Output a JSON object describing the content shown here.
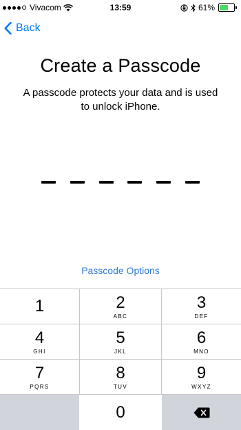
{
  "status_bar": {
    "carrier": "Vivacom",
    "time": "13:59",
    "battery_percent": "61%",
    "battery_level": 0.61,
    "battery_color": "#4cd964"
  },
  "nav": {
    "back_label": "Back",
    "accent_color": "#007aff"
  },
  "main": {
    "title": "Create a Passcode",
    "description": "A passcode protects your data and is used to unlock iPhone.",
    "options_label": "Passcode Options",
    "dash_count": 6
  },
  "keypad": {
    "keys": [
      {
        "digit": "1",
        "letters": ""
      },
      {
        "digit": "2",
        "letters": "ABC"
      },
      {
        "digit": "3",
        "letters": "DEF"
      },
      {
        "digit": "4",
        "letters": "GHI"
      },
      {
        "digit": "5",
        "letters": "JKL"
      },
      {
        "digit": "6",
        "letters": "MNO"
      },
      {
        "digit": "7",
        "letters": "PQRS"
      },
      {
        "digit": "8",
        "letters": "TUV"
      },
      {
        "digit": "9",
        "letters": "WXYZ"
      },
      {
        "digit": "0",
        "letters": ""
      }
    ],
    "delete_icon": "delete-backspace-icon"
  }
}
